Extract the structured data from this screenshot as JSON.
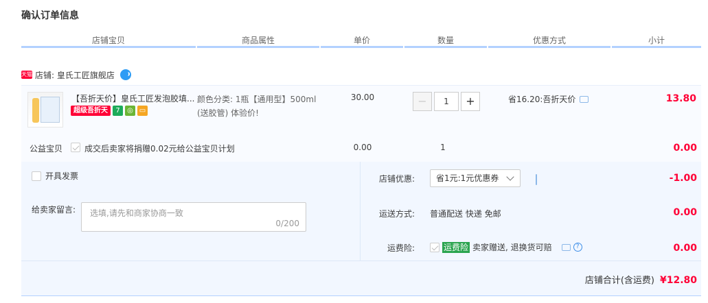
{
  "page": {
    "title": "确认订单信息"
  },
  "columns": [
    "店铺宝贝",
    "商品属性",
    "单价",
    "数量",
    "优惠方式",
    "小计"
  ],
  "shop": {
    "badge": "天猫",
    "label": "店铺: 皇氏工匠旗舰店"
  },
  "item": {
    "title": "【吾折天价】皇氏工匠发泡胶填...",
    "promo_badge": "超级吾折天",
    "attr_line1": "颜色分类: 1瓶【通用型】500ml",
    "attr_line2": "(送胶管)  体验价!",
    "price": "30.00",
    "quantity": "1",
    "discount": "省16.20:吾折天价",
    "subtotal": "13.80",
    "minus": "−",
    "plus": "+"
  },
  "charity": {
    "label": "公益宝贝",
    "text": "成交后卖家将捐赠0.02元给公益宝贝计划",
    "price": "0.00",
    "quantity": "1",
    "subtotal": "0.00"
  },
  "invoice": {
    "label": "开具发票"
  },
  "message": {
    "label": "给卖家留言:",
    "placeholder": "选填,请先和商家协商一致",
    "count": "0/200"
  },
  "shop_discount": {
    "label": "店铺优惠:",
    "selected": "省1元:1元优惠券",
    "value": "-1.00"
  },
  "shipping": {
    "label": "运送方式:",
    "value_text": "普通配送 快递 免邮",
    "value": "0.00"
  },
  "insurance": {
    "label": "运费险:",
    "badge": "运费险",
    "text": "卖家赠送, 退换货可赔",
    "value": "0.00"
  },
  "total": {
    "label": "店铺合计(含运费)",
    "value": "¥12.80"
  }
}
